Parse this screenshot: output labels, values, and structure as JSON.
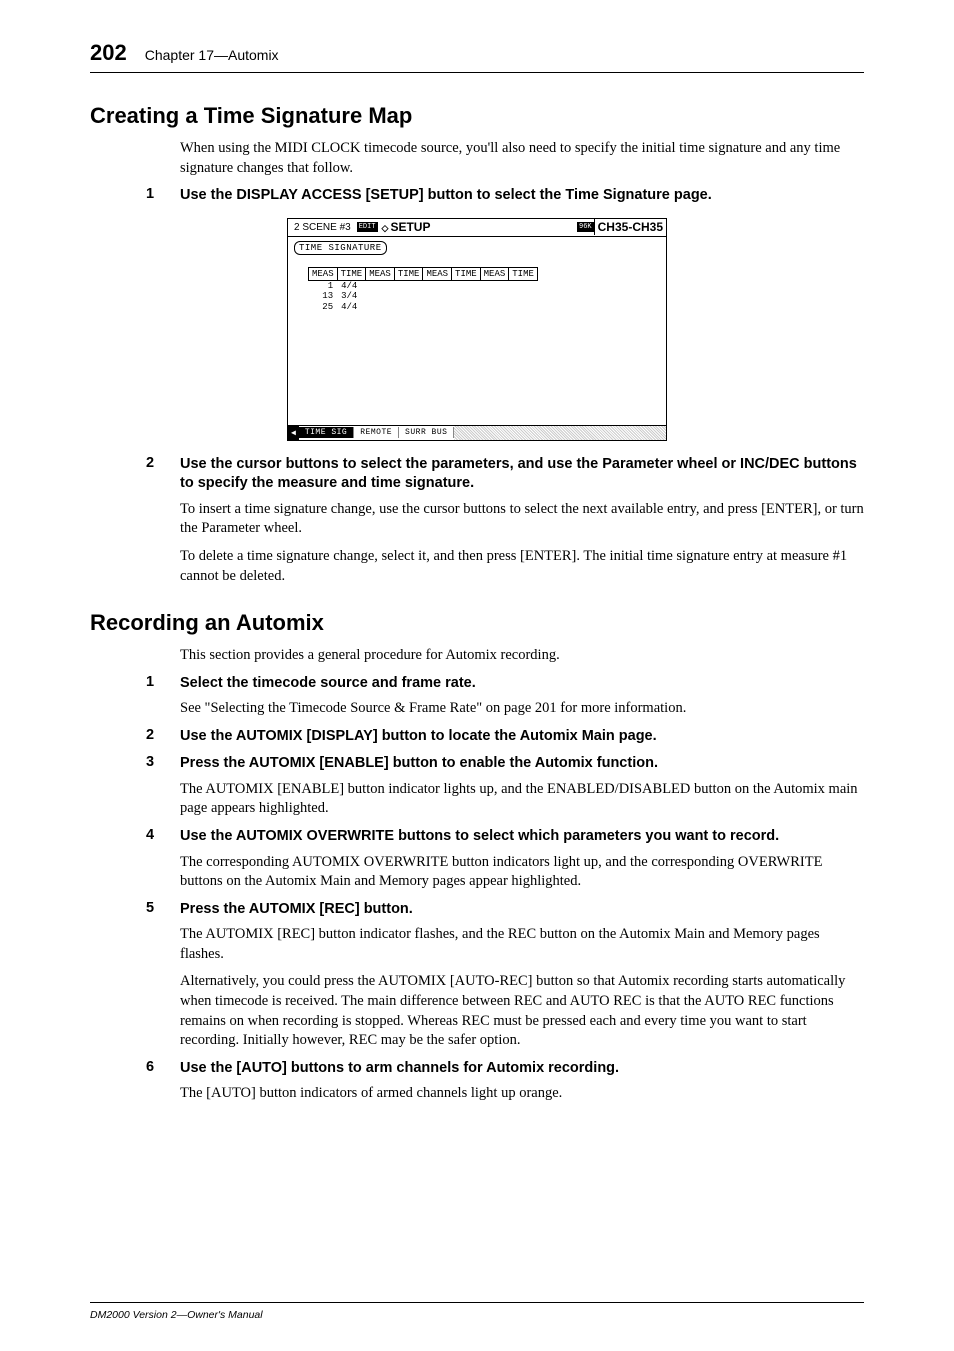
{
  "header": {
    "page_number": "202",
    "chapter": "Chapter 17—Automix"
  },
  "section1": {
    "heading": "Creating a Time Signature Map",
    "intro": "When using the MIDI CLOCK timecode source, you'll also need to specify the initial time signature and any time signature changes that follow.",
    "step1": {
      "num": "1",
      "text": "Use the DISPLAY ACCESS [SETUP] button to select the Time Signature page."
    },
    "step2": {
      "num": "2",
      "text": "Use the cursor buttons to select the parameters, and use the Parameter wheel or INC/DEC buttons to specify the measure and time signature.",
      "body1": "To insert a time signature change, use the cursor buttons to select the next available entry, and press [ENTER], or turn the Parameter wheel.",
      "body2": "To delete a time signature change, select it, and then press [ENTER]. The initial time signature entry at measure #1 cannot be deleted."
    }
  },
  "lcd": {
    "scene": "2 SCENE #3",
    "edit": "EDIT",
    "setup": "SETUP",
    "ch_icon": "96K",
    "ch_range": "CH35-CH35",
    "box_label": "TIME SIGNATURE",
    "cols": [
      "MEAS",
      "TIME",
      "MEAS",
      "TIME",
      "MEAS",
      "TIME",
      "MEAS",
      "TIME"
    ],
    "rows": [
      {
        "meas": "1",
        "time": "4/4"
      },
      {
        "meas": "13",
        "time": "3/4"
      },
      {
        "meas": "25",
        "time": "4/4"
      }
    ],
    "tabs": {
      "arrow": "◀",
      "t1": "TIME SIG",
      "t2": "REMOTE",
      "t3": "SURR BUS"
    }
  },
  "section2": {
    "heading": "Recording an Automix",
    "intro": "This section provides a general procedure for Automix recording.",
    "step1": {
      "num": "1",
      "text": "Select the timecode source and frame rate.",
      "body": "See \"Selecting the Timecode Source & Frame Rate\" on page 201 for more information."
    },
    "step2": {
      "num": "2",
      "text": "Use the AUTOMIX [DISPLAY] button to locate the Automix Main page."
    },
    "step3": {
      "num": "3",
      "text": "Press the AUTOMIX [ENABLE] button to enable the Automix function.",
      "body": "The AUTOMIX [ENABLE] button indicator lights up, and the ENABLED/DISABLED button on the Automix main page appears highlighted."
    },
    "step4": {
      "num": "4",
      "text": "Use the AUTOMIX OVERWRITE buttons to select which parameters you want to record.",
      "body": "The corresponding AUTOMIX OVERWRITE button indicators light up, and the corresponding OVERWRITE buttons on the Automix Main and Memory pages appear highlighted."
    },
    "step5": {
      "num": "5",
      "text": "Press the AUTOMIX [REC] button.",
      "body1": "The AUTOMIX [REC] button indicator flashes, and the REC button on the Automix Main and Memory pages flashes.",
      "body2": "Alternatively, you could press the AUTOMIX [AUTO-REC] button so that Automix recording starts automatically when timecode is received. The main difference between REC and AUTO REC is that the AUTO REC functions remains on when recording is stopped. Whereas REC must be pressed each and every time you want to start recording. Initially however, REC may be the safer option."
    },
    "step6": {
      "num": "6",
      "text": "Use the [AUTO] buttons to arm channels for Automix recording.",
      "body": "The [AUTO] button indicators of armed channels light up orange."
    }
  },
  "footer": "DM2000 Version 2—Owner's Manual"
}
